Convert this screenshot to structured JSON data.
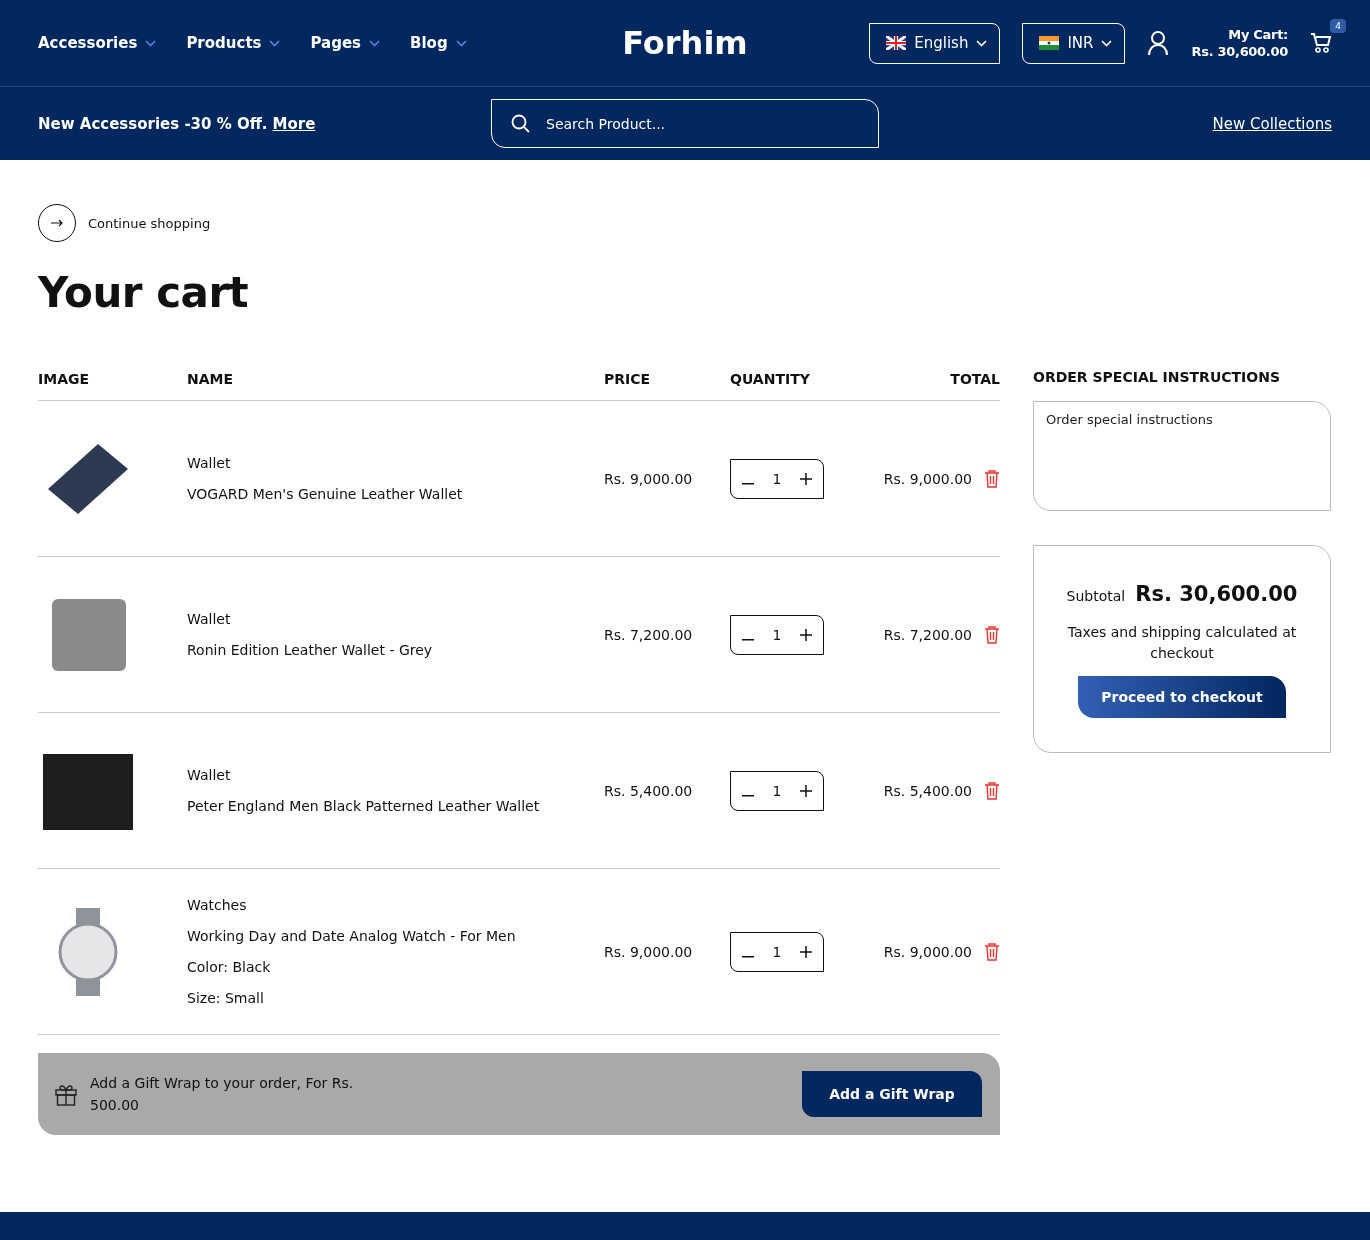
{
  "nav": {
    "items": [
      {
        "label": "Accessories"
      },
      {
        "label": "Products"
      },
      {
        "label": "Pages"
      },
      {
        "label": "Blog"
      }
    ],
    "logo": "Forhim",
    "language": "English",
    "currency": "INR",
    "cart": {
      "label": "My Cart:",
      "amount": "Rs. 30,600.00",
      "count": "4"
    }
  },
  "subbar": {
    "promo": "New Accessories -30 % Off.",
    "promo_link": "More",
    "search": {
      "placeholder": "Search Product..."
    },
    "link": "New Collections"
  },
  "continue": "Continue shopping",
  "title": "Your cart",
  "table": {
    "columns": [
      "IMAGE",
      "NAME",
      "PRICE",
      "QUANTITY",
      "TOTAL"
    ],
    "rows": [
      {
        "category": "Wallet",
        "name": "VOGARD Men's Genuine Leather Wallet",
        "price": "Rs. 9,000.00",
        "quantity": "1",
        "total": "Rs. 9,000.00",
        "kind": "dark-wallet",
        "options": []
      },
      {
        "category": "Wallet",
        "name": "Ronin Edition Leather Wallet - Grey",
        "price": "Rs. 7,200.00",
        "quantity": "1",
        "total": "Rs. 7,200.00",
        "kind": "grey-wallet",
        "options": []
      },
      {
        "category": "Wallet",
        "name": "Peter England Men Black Patterned Leather Wallet",
        "price": "Rs. 5,400.00",
        "quantity": "1",
        "total": "Rs. 5,400.00",
        "kind": "black-wallet",
        "options": []
      },
      {
        "category": "Watches",
        "name": "Working Day and Date Analog Watch - For Men",
        "price": "Rs. 9,000.00",
        "quantity": "1",
        "total": "Rs. 9,000.00",
        "kind": "watch",
        "options": [
          {
            "label": "Color:",
            "value": "Black"
          },
          {
            "label": "Size:",
            "value": "Small"
          }
        ]
      }
    ]
  },
  "gift": {
    "text": "Add a Gift Wrap to your order, For Rs. 500.00",
    "button": "Add a Gift Wrap"
  },
  "instructions": {
    "title": "ORDER SPECIAL INSTRUCTIONS",
    "placeholder": "Order special instructions"
  },
  "summary": {
    "subtotal_label": "Subtotal",
    "subtotal": "Rs. 30,600.00",
    "note": "Taxes and shipping calculated at checkout",
    "button": "Proceed to checkout"
  }
}
